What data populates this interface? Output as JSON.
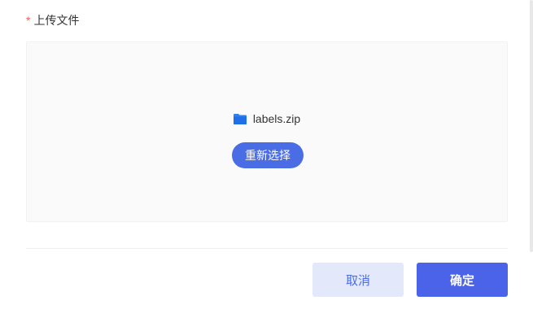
{
  "form": {
    "required_mark": "*",
    "field_label": "上传文件"
  },
  "upload": {
    "file_icon": "folder-icon",
    "file_name": "labels.zip",
    "reselect_label": "重新选择"
  },
  "footer": {
    "cancel_label": "取消",
    "confirm_label": "确定"
  },
  "colors": {
    "primary": "#4a6de5",
    "cancel_bg": "#e3e8fb",
    "required": "#f25b5b",
    "upload_bg": "#fafafa",
    "folder": "#2f7ff0"
  }
}
